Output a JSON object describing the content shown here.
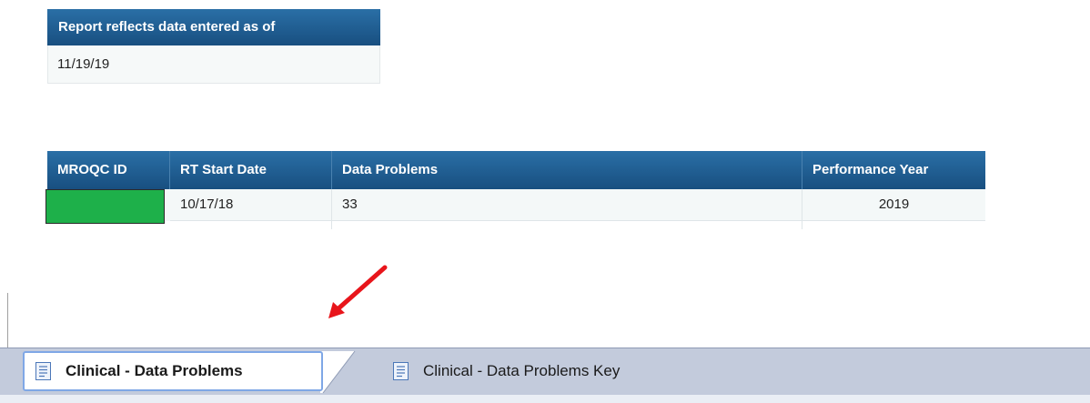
{
  "asof": {
    "header": "Report reflects data entered as of",
    "value": "11/19/19"
  },
  "table": {
    "columns": [
      "MROQC ID",
      "RT Start Date",
      "Data Problems",
      "Performance Year"
    ],
    "rows": [
      {
        "mroqc_id": "",
        "rt_start_date": "10/17/18",
        "data_problems": "33",
        "performance_year": "2019"
      }
    ]
  },
  "tabs": [
    {
      "label": "Clinical - Data Problems",
      "icon": "document-icon",
      "active": true
    },
    {
      "label": "Clinical - Data Problems Key",
      "icon": "document-icon",
      "active": false
    }
  ],
  "colors": {
    "header_blue": "#1d5d90",
    "redacted_green": "#1eb04a",
    "arrow_red": "#e8151b",
    "tab_strip": "#c3cbdc",
    "active_tab_border": "#7fa7e6"
  }
}
